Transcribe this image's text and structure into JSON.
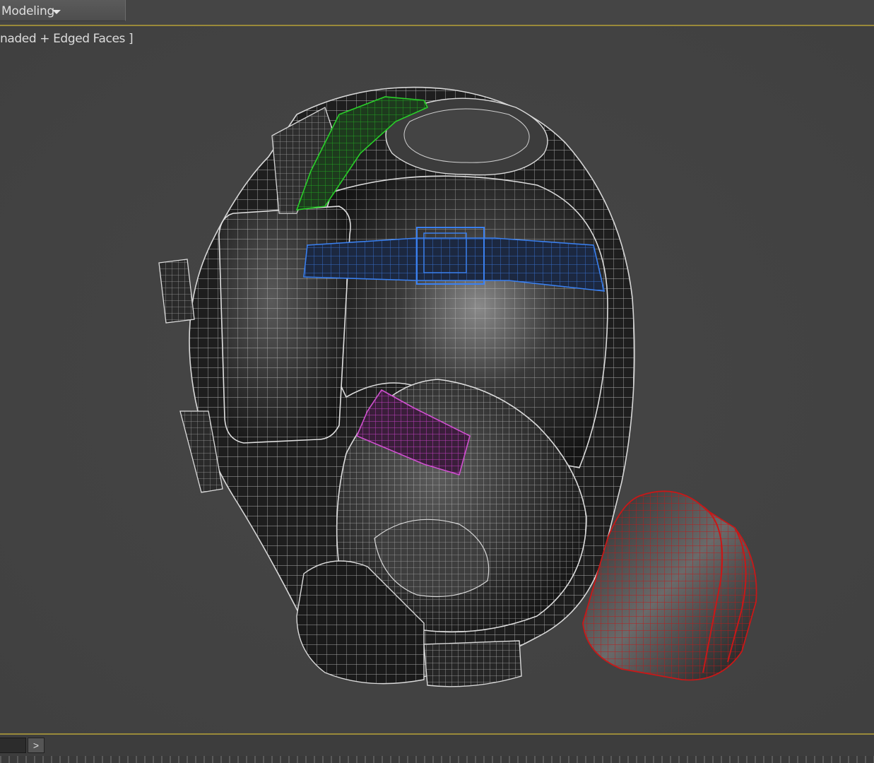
{
  "ribbon": {
    "tab_label": "Modeling",
    "tab_icon": "chevron-down-icon"
  },
  "viewport": {
    "label": "naded + Edged Faces ]",
    "border_color": "#9a8a3a",
    "object_colors": {
      "mesh": "#c8c8c8",
      "strap_top": "#1faa1f",
      "strap_middle": "#2f6fd8",
      "buckle": "#c040c0",
      "filter": "#b01010"
    }
  },
  "timeline": {
    "next_label": ">",
    "next_icon": "next-frame-icon"
  }
}
